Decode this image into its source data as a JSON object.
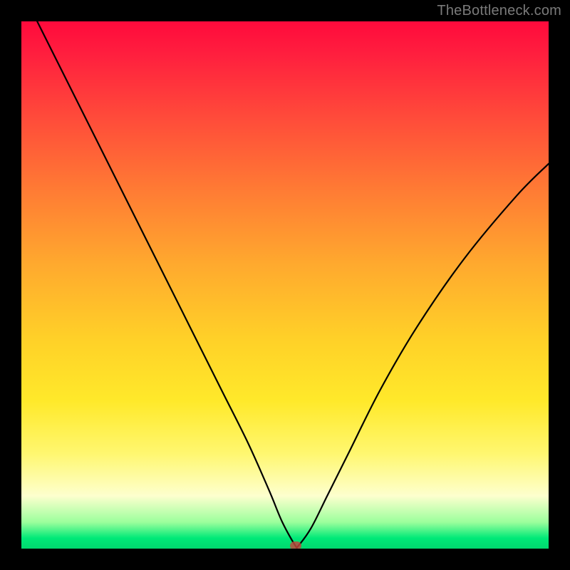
{
  "watermark": "TheBottleneck.com",
  "chart_data": {
    "type": "line",
    "title": "",
    "xlabel": "",
    "ylabel": "",
    "xlim": [
      0,
      100
    ],
    "ylim": [
      0,
      100
    ],
    "grid": false,
    "legend": false,
    "series": [
      {
        "name": "bottleneck-curve",
        "x": [
          3,
          8,
          14,
          20,
          26,
          32,
          38,
          43,
          47,
          49.5,
          52,
          52.5,
          55,
          58,
          62,
          68,
          75,
          84,
          94,
          100
        ],
        "values": [
          100,
          90,
          78,
          66,
          54,
          42,
          30,
          20,
          11,
          5,
          0.5,
          0.5,
          4,
          10,
          18,
          30,
          42,
          55,
          67,
          73
        ]
      }
    ],
    "marker": {
      "x": 52,
      "y": 0.6,
      "color": "#c4463c"
    },
    "background_gradient": {
      "top_color": "#ff0a3c",
      "bottom_color": "#00d86e",
      "stops": [
        "red",
        "orange",
        "yellow",
        "pale-yellow",
        "green"
      ]
    }
  }
}
